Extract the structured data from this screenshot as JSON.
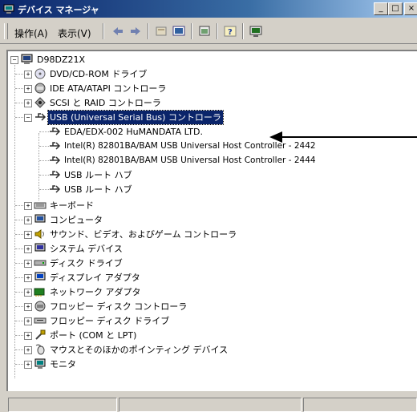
{
  "window": {
    "title": "デバイス マネージャ",
    "buttons": {
      "minimize": "_",
      "maximize": "□",
      "close": "×"
    }
  },
  "menu": {
    "action": "操作(A)",
    "view": "表示(V)"
  },
  "toolbar": {
    "icons": [
      "back-arrow-icon",
      "forward-arrow-icon",
      "properties-page-icon",
      "computer-view-icon",
      "scan-icon",
      "help-icon",
      "monitor-icon"
    ]
  },
  "tree": {
    "root": "D98DZ21X",
    "items": [
      {
        "label": "DVD/CD-ROM ドライブ",
        "icon": "cdrom-icon",
        "state": "collapsed"
      },
      {
        "label": "IDE ATA/ATAPI コントローラ",
        "icon": "ide-icon",
        "state": "collapsed"
      },
      {
        "label": "SCSI と RAID コントローラ",
        "icon": "scsi-icon",
        "state": "collapsed"
      },
      {
        "label": "USB (Universal Serial Bus) コントローラ",
        "icon": "usb-icon",
        "state": "expanded",
        "selected": true
      }
    ],
    "usb_children": [
      "EDA/EDX-002 HuMANDATA LTD.",
      "Intel(R) 82801BA/BAM USB Universal Host Controller - 2442",
      "Intel(R) 82801BA/BAM USB Universal Host Controller - 2444",
      "USB ルート ハブ",
      "USB ルート ハブ"
    ],
    "items_after": [
      {
        "label": "キーボード",
        "icon": "keyboard-icon"
      },
      {
        "label": "コンピュータ",
        "icon": "computer-icon"
      },
      {
        "label": "サウンド、ビデオ、およびゲーム コントローラ",
        "icon": "sound-icon"
      },
      {
        "label": "システム デバイス",
        "icon": "system-icon"
      },
      {
        "label": "ディスク ドライブ",
        "icon": "disk-icon"
      },
      {
        "label": "ディスプレイ アダプタ",
        "icon": "display-icon"
      },
      {
        "label": "ネットワーク アダプタ",
        "icon": "network-icon"
      },
      {
        "label": "フロッピー ディスク コントローラ",
        "icon": "floppy-controller-icon"
      },
      {
        "label": "フロッピー ディスク ドライブ",
        "icon": "floppy-drive-icon"
      },
      {
        "label": "ポート (COM と LPT)",
        "icon": "port-icon"
      },
      {
        "label": "マウスとそのほかのポインティング デバイス",
        "icon": "mouse-icon"
      },
      {
        "label": "モニタ",
        "icon": "monitor-icon"
      }
    ]
  },
  "colors": {
    "selection": "#0a246a",
    "title_start": "#0a246a",
    "title_end": "#a6caf0",
    "face": "#d4d0c8"
  }
}
